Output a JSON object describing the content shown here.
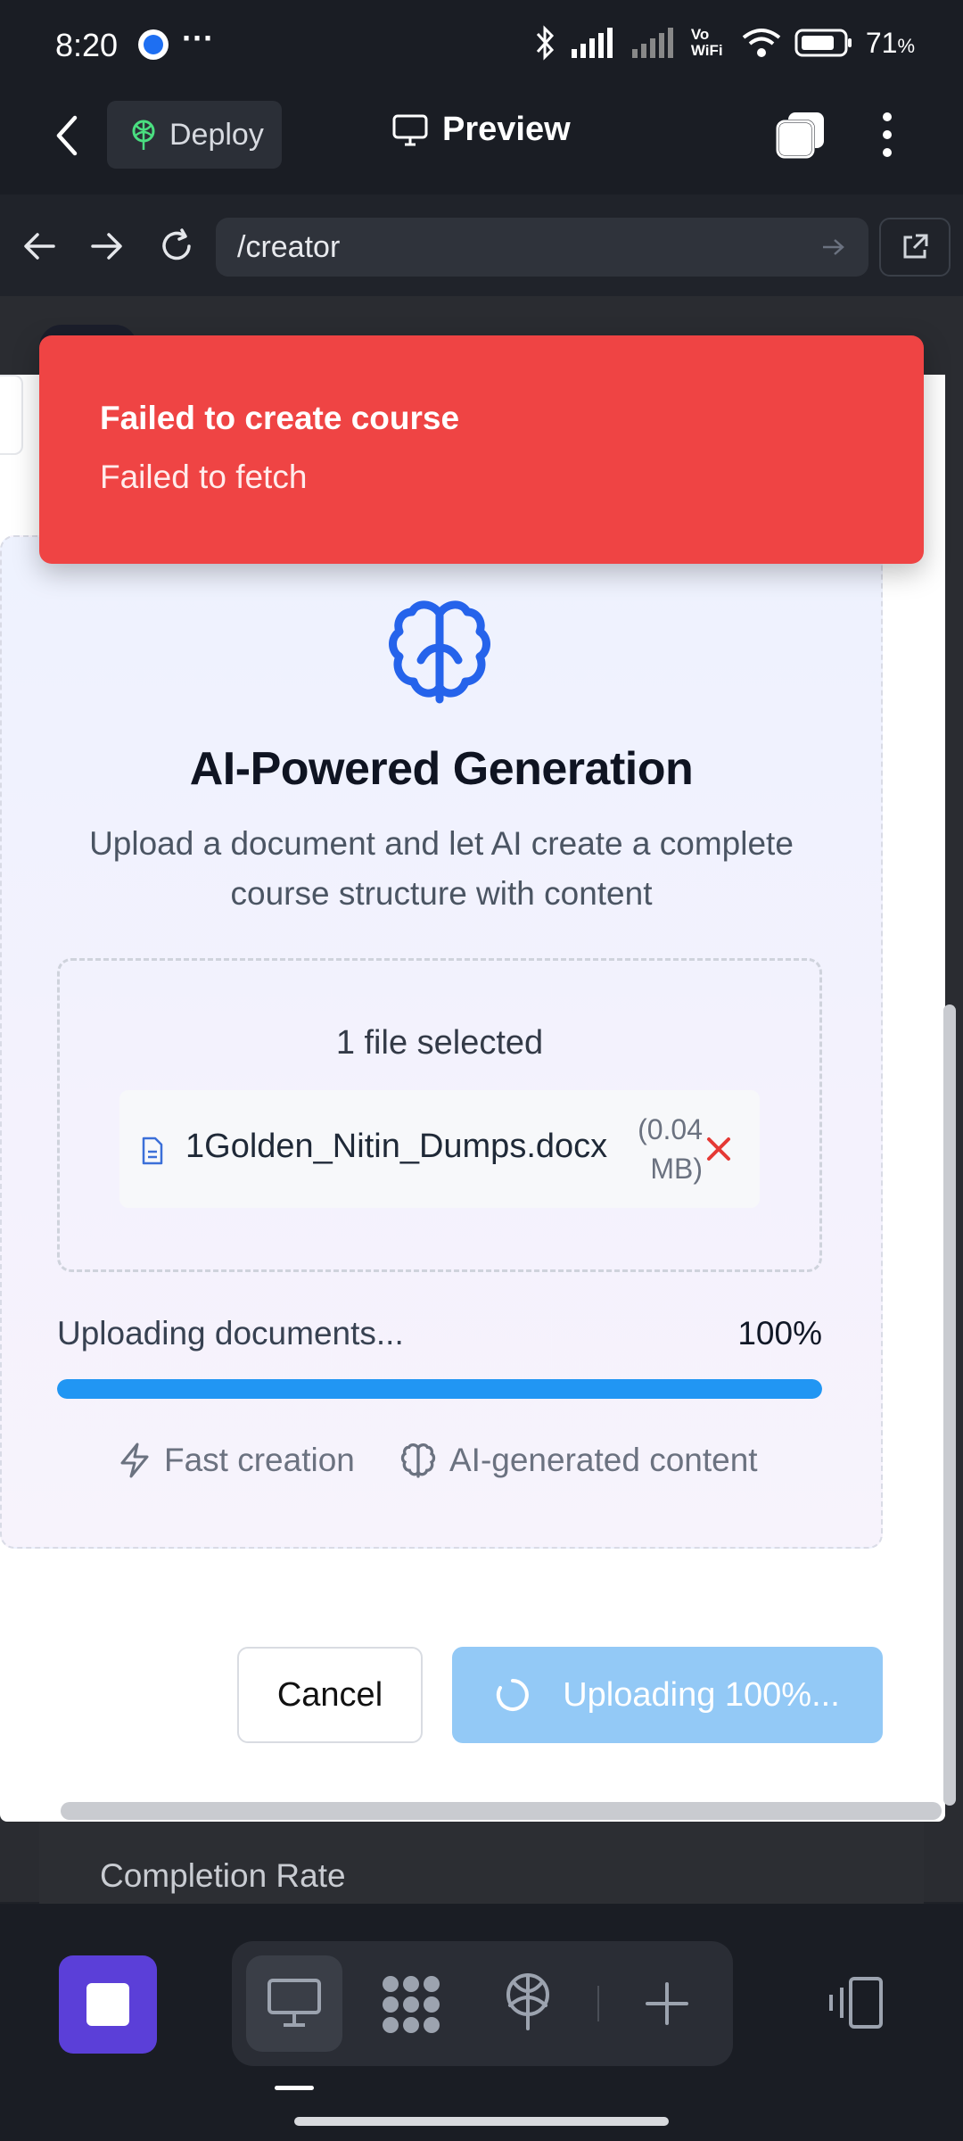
{
  "status_bar": {
    "time": "8:20",
    "more": "···",
    "vowifi": "Vo WiFi",
    "battery": "71",
    "battery_unit": "%"
  },
  "header": {
    "deploy_label": "Deploy",
    "preview_label": "Preview"
  },
  "browser": {
    "url": "/creator"
  },
  "toast": {
    "title": "Failed to create course",
    "message": "Failed to fetch"
  },
  "ai_card": {
    "title": "AI-Powered Generation",
    "description": "Upload a document and let AI create a complete course structure with content",
    "files_selected": "1 file selected",
    "file": {
      "name": "1Golden_Nitin_Dumps.docx",
      "size": "(0.04 MB)"
    },
    "upload_status": "Uploading documents...",
    "upload_percent_label": "100%",
    "upload_progress": 1.0,
    "features": [
      "Fast creation",
      "AI-generated content"
    ]
  },
  "buttons": {
    "cancel": "Cancel",
    "uploading": "Uploading 100%..."
  },
  "background": {
    "completion_rate": "Completion Rate"
  },
  "colors": {
    "toast": "#ef4444",
    "accent": "#2196f3",
    "deploy_icon": "#4ade80",
    "brain_icon": "#2563eb",
    "remove": "#e53935",
    "stop": "#5b3fd8"
  },
  "icons": [
    "back-chevron-icon",
    "deploy-icon",
    "monitor-icon",
    "tabs-icon",
    "kebab-menu-icon",
    "arrow-back-icon",
    "arrow-forward-icon",
    "reload-icon",
    "external-link-icon",
    "brain-icon",
    "document-icon",
    "close-icon",
    "lightning-icon",
    "spinner-icon",
    "stop-icon",
    "desktop-icon",
    "grid-icon",
    "globe-antenna-icon",
    "plus-icon",
    "device-switch-icon"
  ]
}
